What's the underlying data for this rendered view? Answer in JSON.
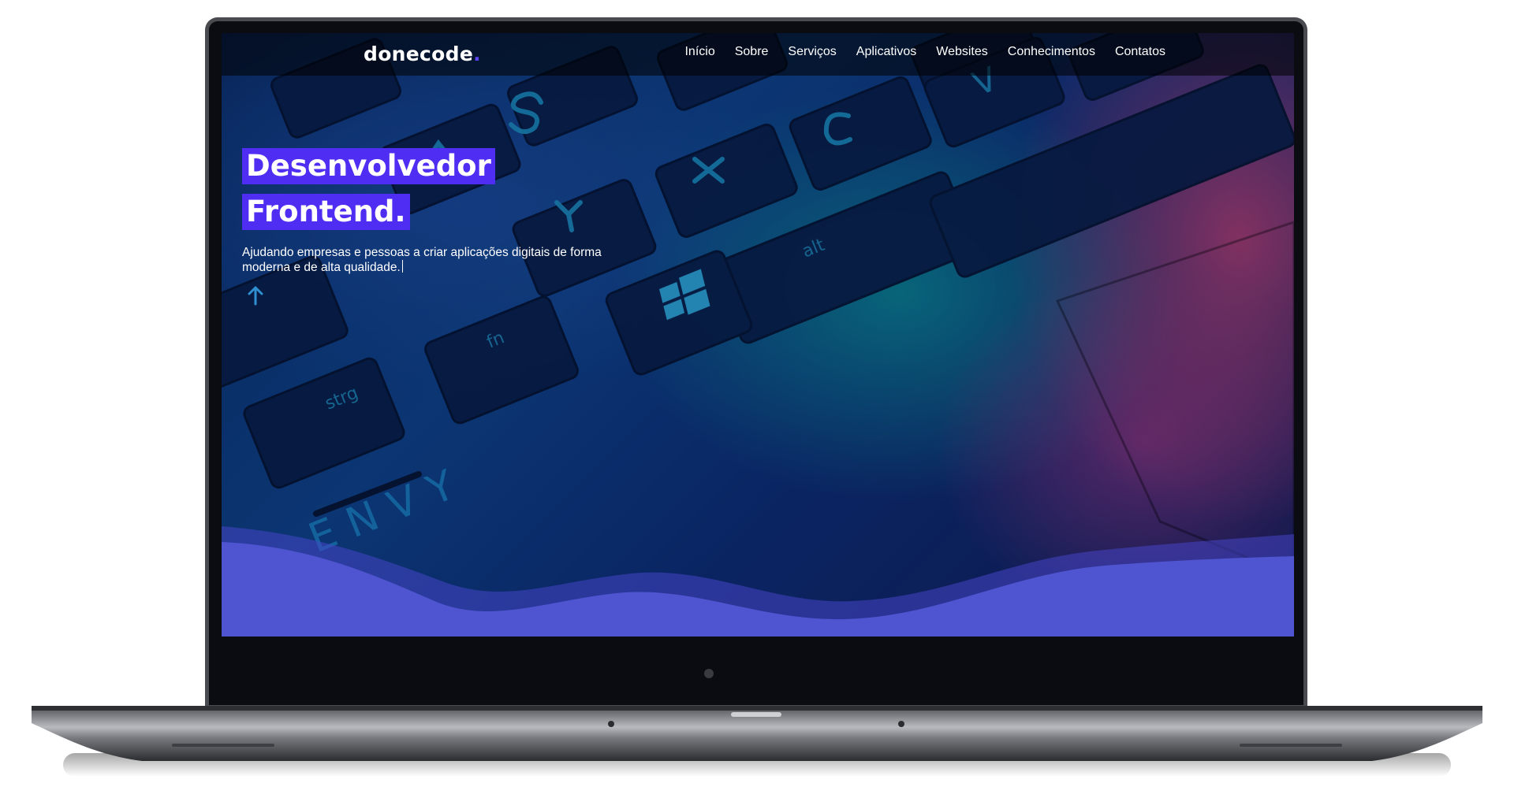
{
  "site": {
    "logo_text": "donecode",
    "logo_dot": ".",
    "accent_color": "#4f2df2"
  },
  "nav": {
    "items": [
      {
        "label": "Início"
      },
      {
        "label": "Sobre"
      },
      {
        "label": "Serviços"
      },
      {
        "label": "Aplicativos"
      },
      {
        "label": "Websites"
      },
      {
        "label": "Conhecimentos"
      },
      {
        "label": "Contatos"
      }
    ]
  },
  "hero": {
    "title_line1": "Desenvolvedor",
    "title_line2": "Frontend.",
    "subtitle": "Ajudando empresas e pessoas a criar aplicações digitais de forma moderna e de alta qualidade.",
    "scroll_icon": "arrow-up-icon"
  },
  "keyboard": {
    "keys": [
      "S",
      "C",
      "V",
      "A",
      "X",
      "Y",
      "alt",
      "fn",
      "strg"
    ],
    "engraving": "ENVY"
  }
}
